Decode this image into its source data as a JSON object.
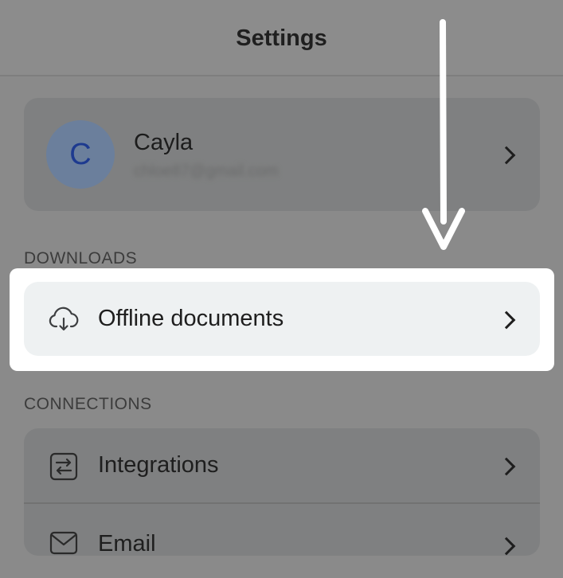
{
  "header": {
    "title": "Settings"
  },
  "profile": {
    "avatar_initial": "C",
    "name": "Cayla",
    "email": "chloe87@gmail.com"
  },
  "sections": {
    "downloads": {
      "label": "DOWNLOADS",
      "items": [
        {
          "label": "Offline documents",
          "icon": "cloud-download-icon"
        }
      ]
    },
    "connections": {
      "label": "CONNECTIONS",
      "items": [
        {
          "label": "Integrations",
          "icon": "integrations-icon"
        },
        {
          "label": "Email",
          "icon": "mail-icon"
        }
      ]
    }
  },
  "colors": {
    "highlight_background": "#ffffff",
    "highlight_row": "#eef1f2",
    "avatar_fill": "#6b7f9c",
    "arrow": "#ffffff"
  }
}
